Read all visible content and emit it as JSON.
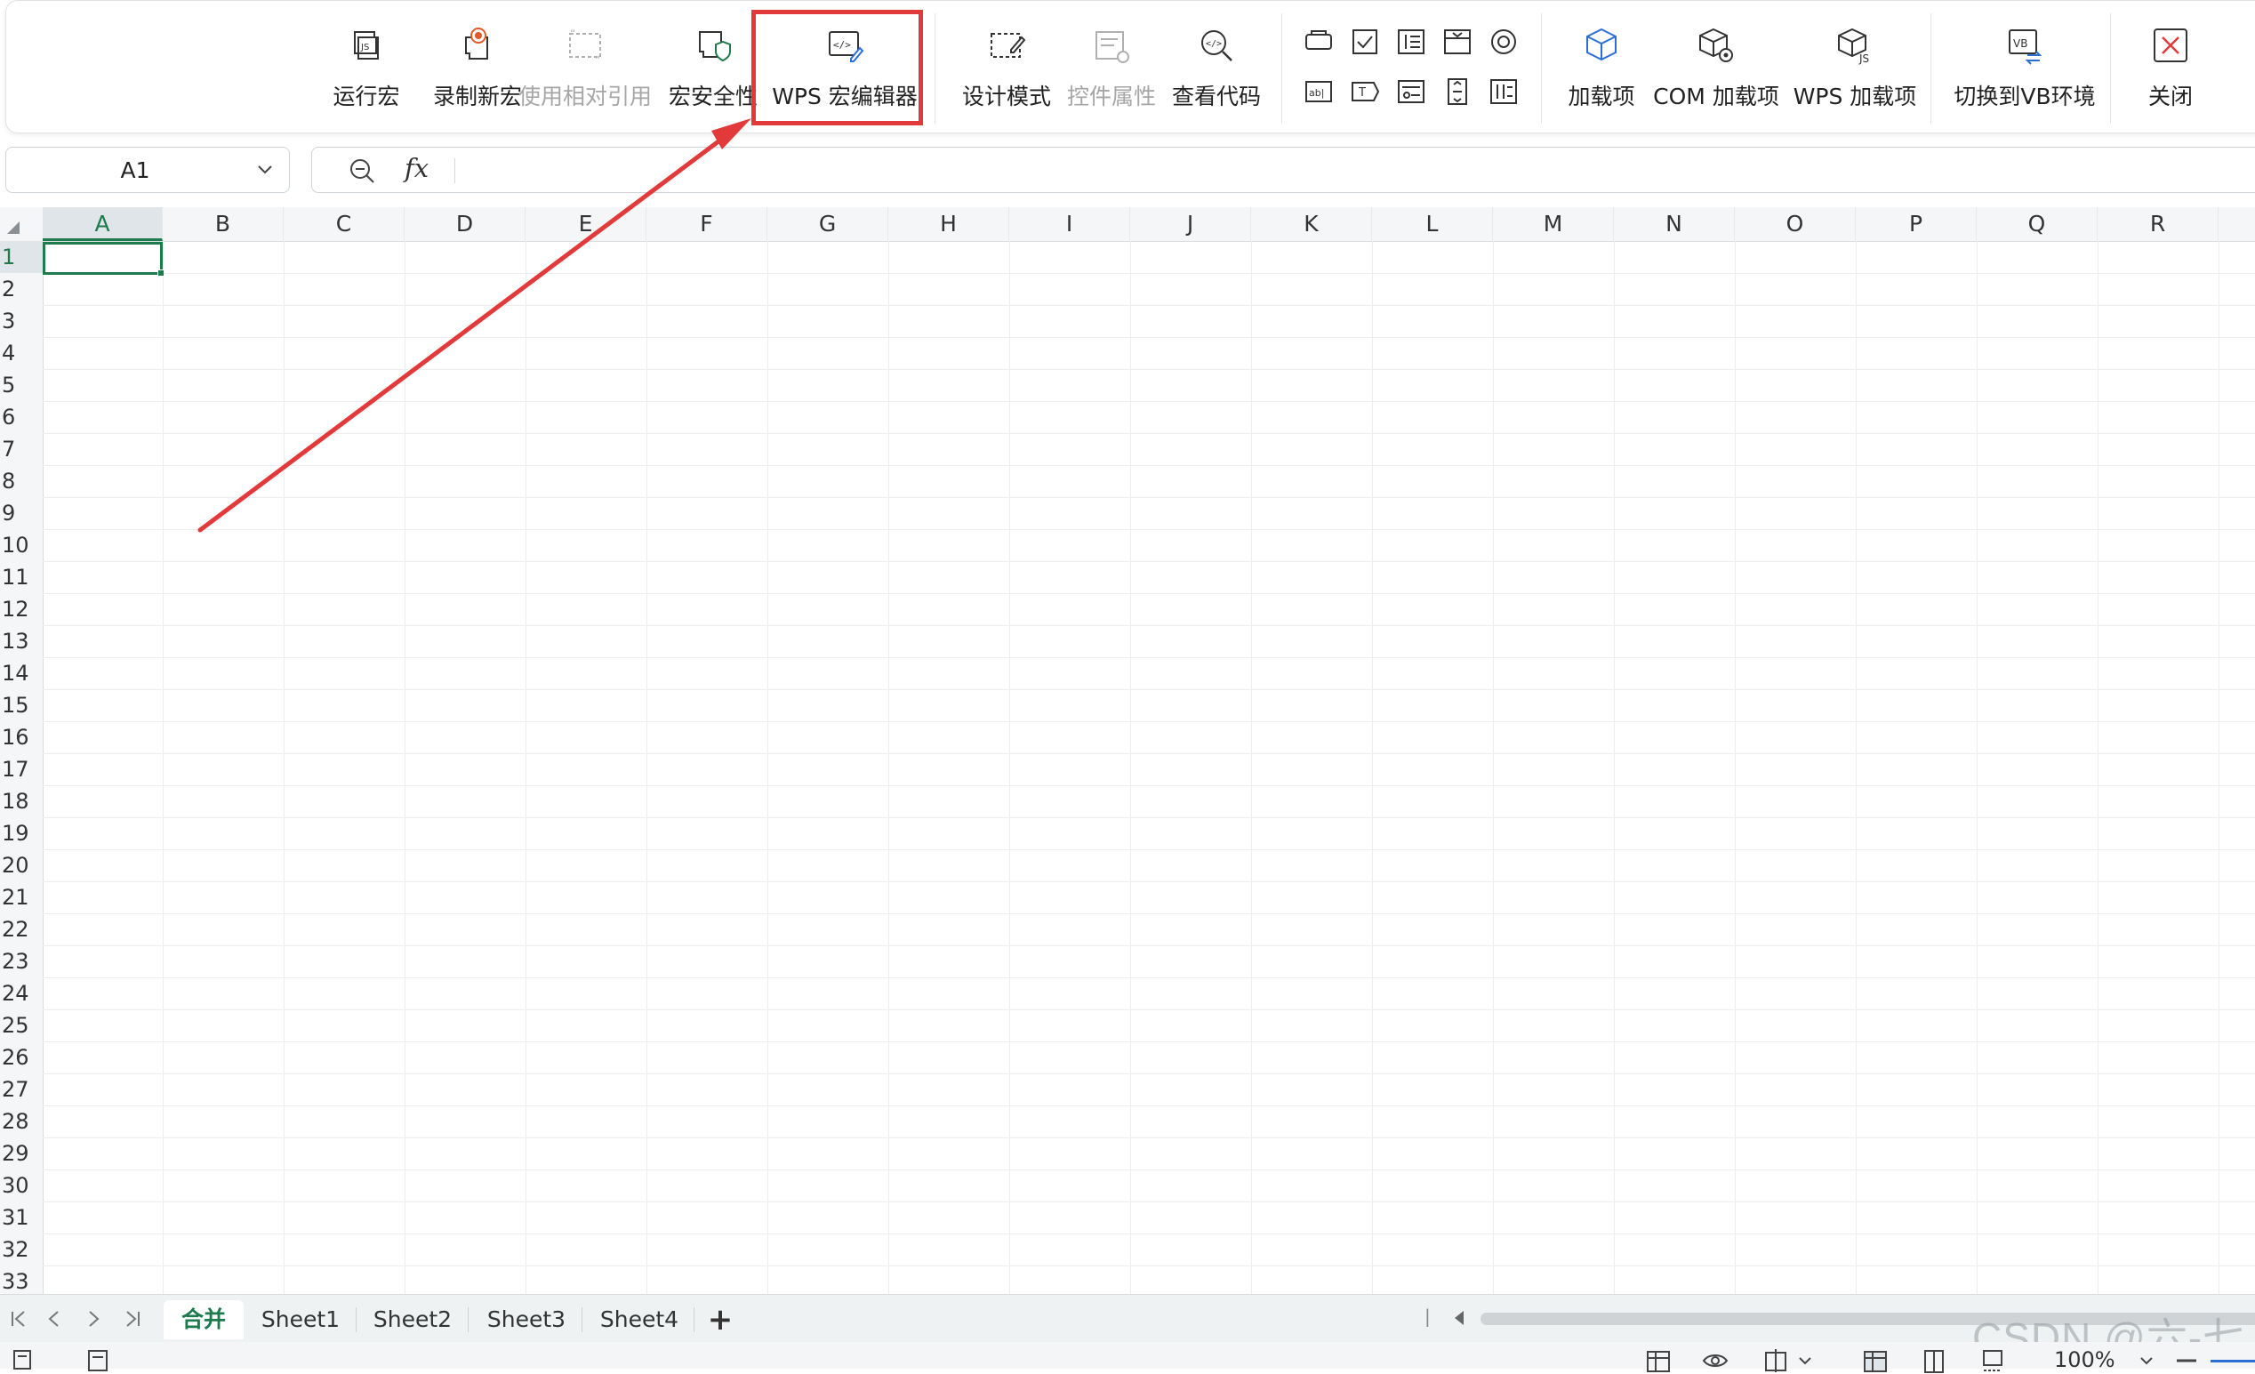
{
  "ribbon": {
    "groups": [
      {
        "label": "运行宏",
        "icon": "run-macro-icon",
        "disabled": false
      },
      {
        "label": "录制新宏",
        "icon": "record-macro-icon",
        "disabled": false
      },
      {
        "label": "使用相对引用",
        "icon": "relative-reference-icon",
        "disabled": true
      },
      {
        "label": "宏安全性",
        "icon": "macro-security-icon",
        "disabled": false
      },
      {
        "label": "WPS 宏编辑器",
        "icon": "macro-editor-icon",
        "disabled": false
      },
      {
        "label": "设计模式",
        "icon": "design-mode-icon",
        "disabled": false
      },
      {
        "label": "控件属性",
        "icon": "control-properties-icon",
        "disabled": true
      },
      {
        "label": "查看代码",
        "icon": "view-code-icon",
        "disabled": false
      },
      {
        "label": "加载项",
        "icon": "addins-icon",
        "disabled": false
      },
      {
        "label": "COM 加载项",
        "icon": "com-addins-icon",
        "disabled": false
      },
      {
        "label": "WPS 加载项",
        "icon": "wps-addins-icon",
        "disabled": false
      },
      {
        "label": "切换到VB环境",
        "icon": "switch-vb-icon",
        "disabled": false
      },
      {
        "label": "关闭",
        "icon": "close-icon",
        "disabled": false
      }
    ],
    "controls_icons": [
      "button-control-icon",
      "checkbox-control-icon",
      "spinner-control-icon",
      "groupbox-control-icon",
      "radio-control-icon",
      "textbox-control-icon",
      "label-control-icon",
      "combobox-control-icon",
      "scrollbar-control-icon",
      "listbox-control-icon"
    ]
  },
  "formula_bar": {
    "cell_ref": "A1",
    "fx_label": "fx",
    "formula": ""
  },
  "grid": {
    "columns": [
      "A",
      "B",
      "C",
      "D",
      "E",
      "F",
      "G",
      "H",
      "I",
      "J",
      "K",
      "L",
      "M",
      "N",
      "O",
      "P",
      "Q",
      "R"
    ],
    "rows": [
      "1",
      "2",
      "3",
      "4",
      "5",
      "6",
      "7",
      "8",
      "9",
      "10",
      "11",
      "12",
      "13",
      "14",
      "15",
      "16",
      "17",
      "18",
      "19",
      "20",
      "21",
      "22",
      "23",
      "24",
      "25",
      "26",
      "27",
      "28",
      "29",
      "30",
      "31",
      "32",
      "33"
    ],
    "selected_column": "A",
    "selected_row": "1"
  },
  "sheet_tabs": {
    "tabs": [
      "合并",
      "Sheet1",
      "Sheet2",
      "Sheet3",
      "Sheet4"
    ],
    "active": "合并",
    "add_label": "+"
  },
  "status_bar": {
    "zoom": "100%"
  },
  "watermark": "CSDN @六-七",
  "colors": {
    "accent_green": "#1d7a4d",
    "annotation_red": "#e23a3a",
    "disabled_text": "#a6a6a6"
  }
}
